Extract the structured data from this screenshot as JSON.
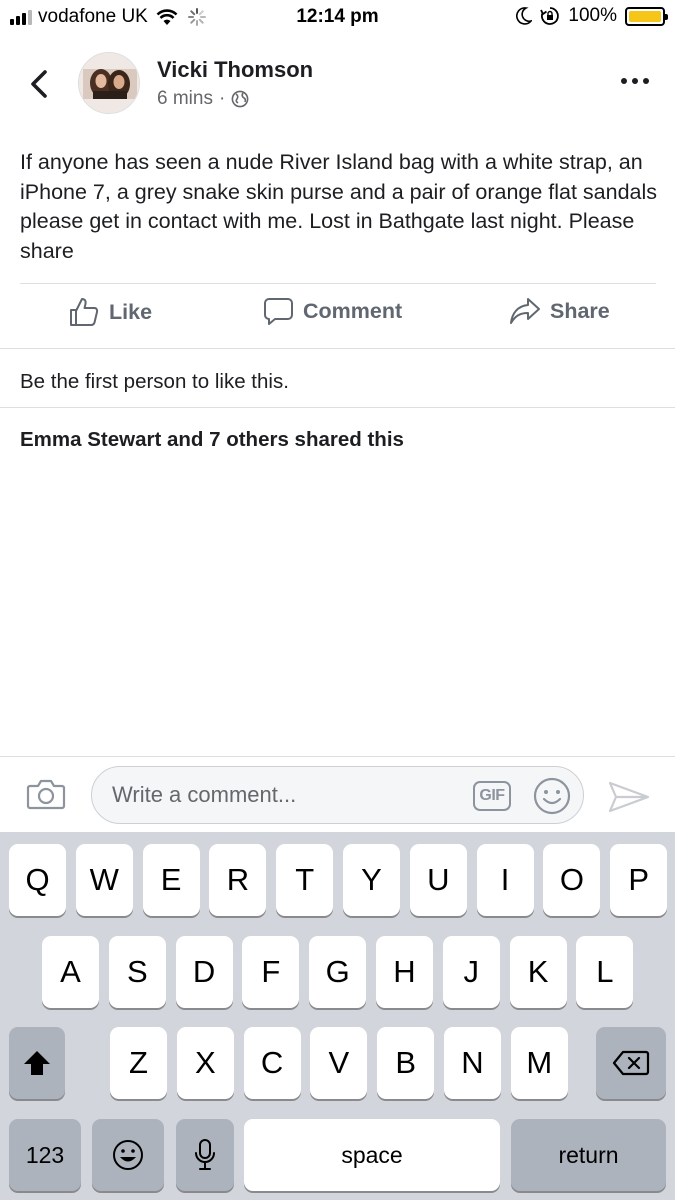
{
  "status_bar": {
    "carrier": "vodafone UK",
    "time": "12:14 pm",
    "battery": "100%"
  },
  "post": {
    "author": "Vicki Thomson",
    "time": "6 mins",
    "separator": "·",
    "text": "If anyone has seen a nude River Island bag with a white strap, an iPhone 7, a grey snake skin purse and a pair of orange flat sandals please get in contact with me. Lost in Bathgate last night. Please share",
    "actions": {
      "like": "Like",
      "comment": "Comment",
      "share": "Share"
    },
    "likes_text": "Be the first person to like this.",
    "shares_text": "Emma Stewart and 7 others shared this"
  },
  "comment_bar": {
    "placeholder": "Write a comment...",
    "gif_label": "GIF"
  },
  "keyboard": {
    "row1": [
      "Q",
      "W",
      "E",
      "R",
      "T",
      "Y",
      "U",
      "I",
      "O",
      "P"
    ],
    "row2": [
      "A",
      "S",
      "D",
      "F",
      "G",
      "H",
      "J",
      "K",
      "L"
    ],
    "row3": [
      "Z",
      "X",
      "C",
      "V",
      "B",
      "N",
      "M"
    ],
    "numbers_label": "123",
    "space_label": "space",
    "return_label": "return"
  },
  "colors": {
    "text": "#1c1e21",
    "secondary": "#65676b",
    "action": "#606770",
    "keyboard_bg": "#d2d5db",
    "battery": "#f5c518"
  },
  "icons": [
    "signal-icon",
    "wifi-icon",
    "spinner-icon",
    "moon-icon",
    "orientation-lock-icon",
    "battery-icon",
    "back-chevron-icon",
    "globe-icon",
    "more-icon",
    "like-icon",
    "comment-icon",
    "share-icon",
    "camera-icon",
    "gif-icon",
    "emoji-icon",
    "send-icon",
    "shift-icon",
    "backspace-icon",
    "emoji-keyboard-icon",
    "microphone-icon"
  ]
}
